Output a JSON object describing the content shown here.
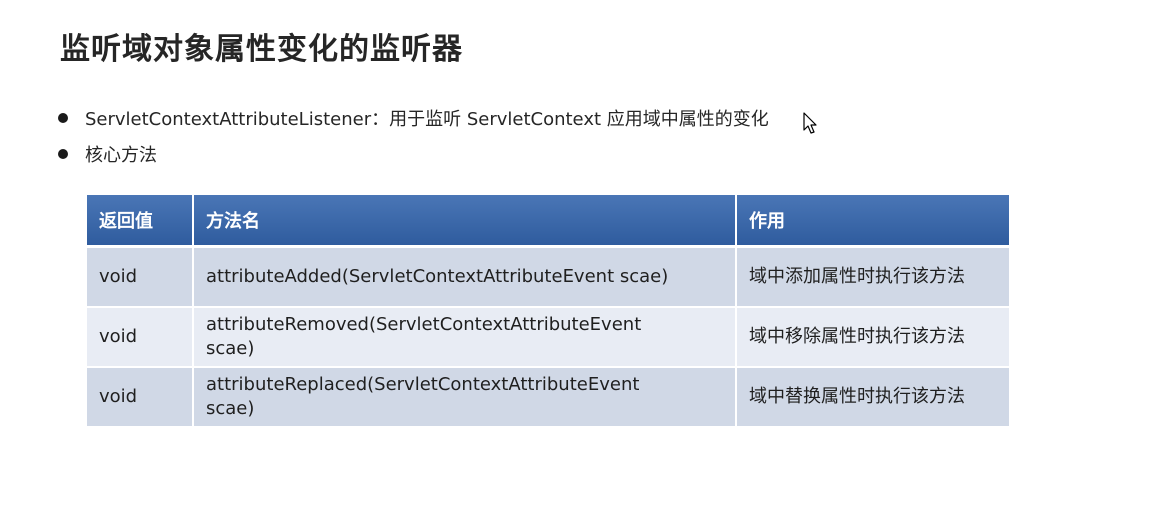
{
  "slide": {
    "title": "监听域对象属性变化的监听器"
  },
  "bullets": [
    {
      "text": "ServletContextAttributeListener：用于监听 ServletContext 应用域中属性的变化"
    },
    {
      "text": "核心方法"
    }
  ],
  "table": {
    "headers": [
      "返回值",
      "方法名",
      "作用"
    ],
    "rows": [
      {
        "return_type": "void",
        "method": "attributeAdded(ServletContextAttributeEvent scae)",
        "purpose": "域中添加属性时执行该方法"
      },
      {
        "return_type": "void",
        "method": "attributeRemoved(ServletContextAttributeEvent scae)",
        "purpose": "域中移除属性时执行该方法"
      },
      {
        "return_type": "void",
        "method": "attributeReplaced(ServletContextAttributeEvent scae)",
        "purpose": "域中替换属性时执行该方法"
      }
    ]
  },
  "colors": {
    "header_bg": "#3a66a6",
    "row_odd_bg": "#d0d8e6",
    "row_even_bg": "#e8ecf4",
    "title_text": "#262626"
  },
  "icons": {
    "cursor": "mouse-pointer-icon"
  }
}
